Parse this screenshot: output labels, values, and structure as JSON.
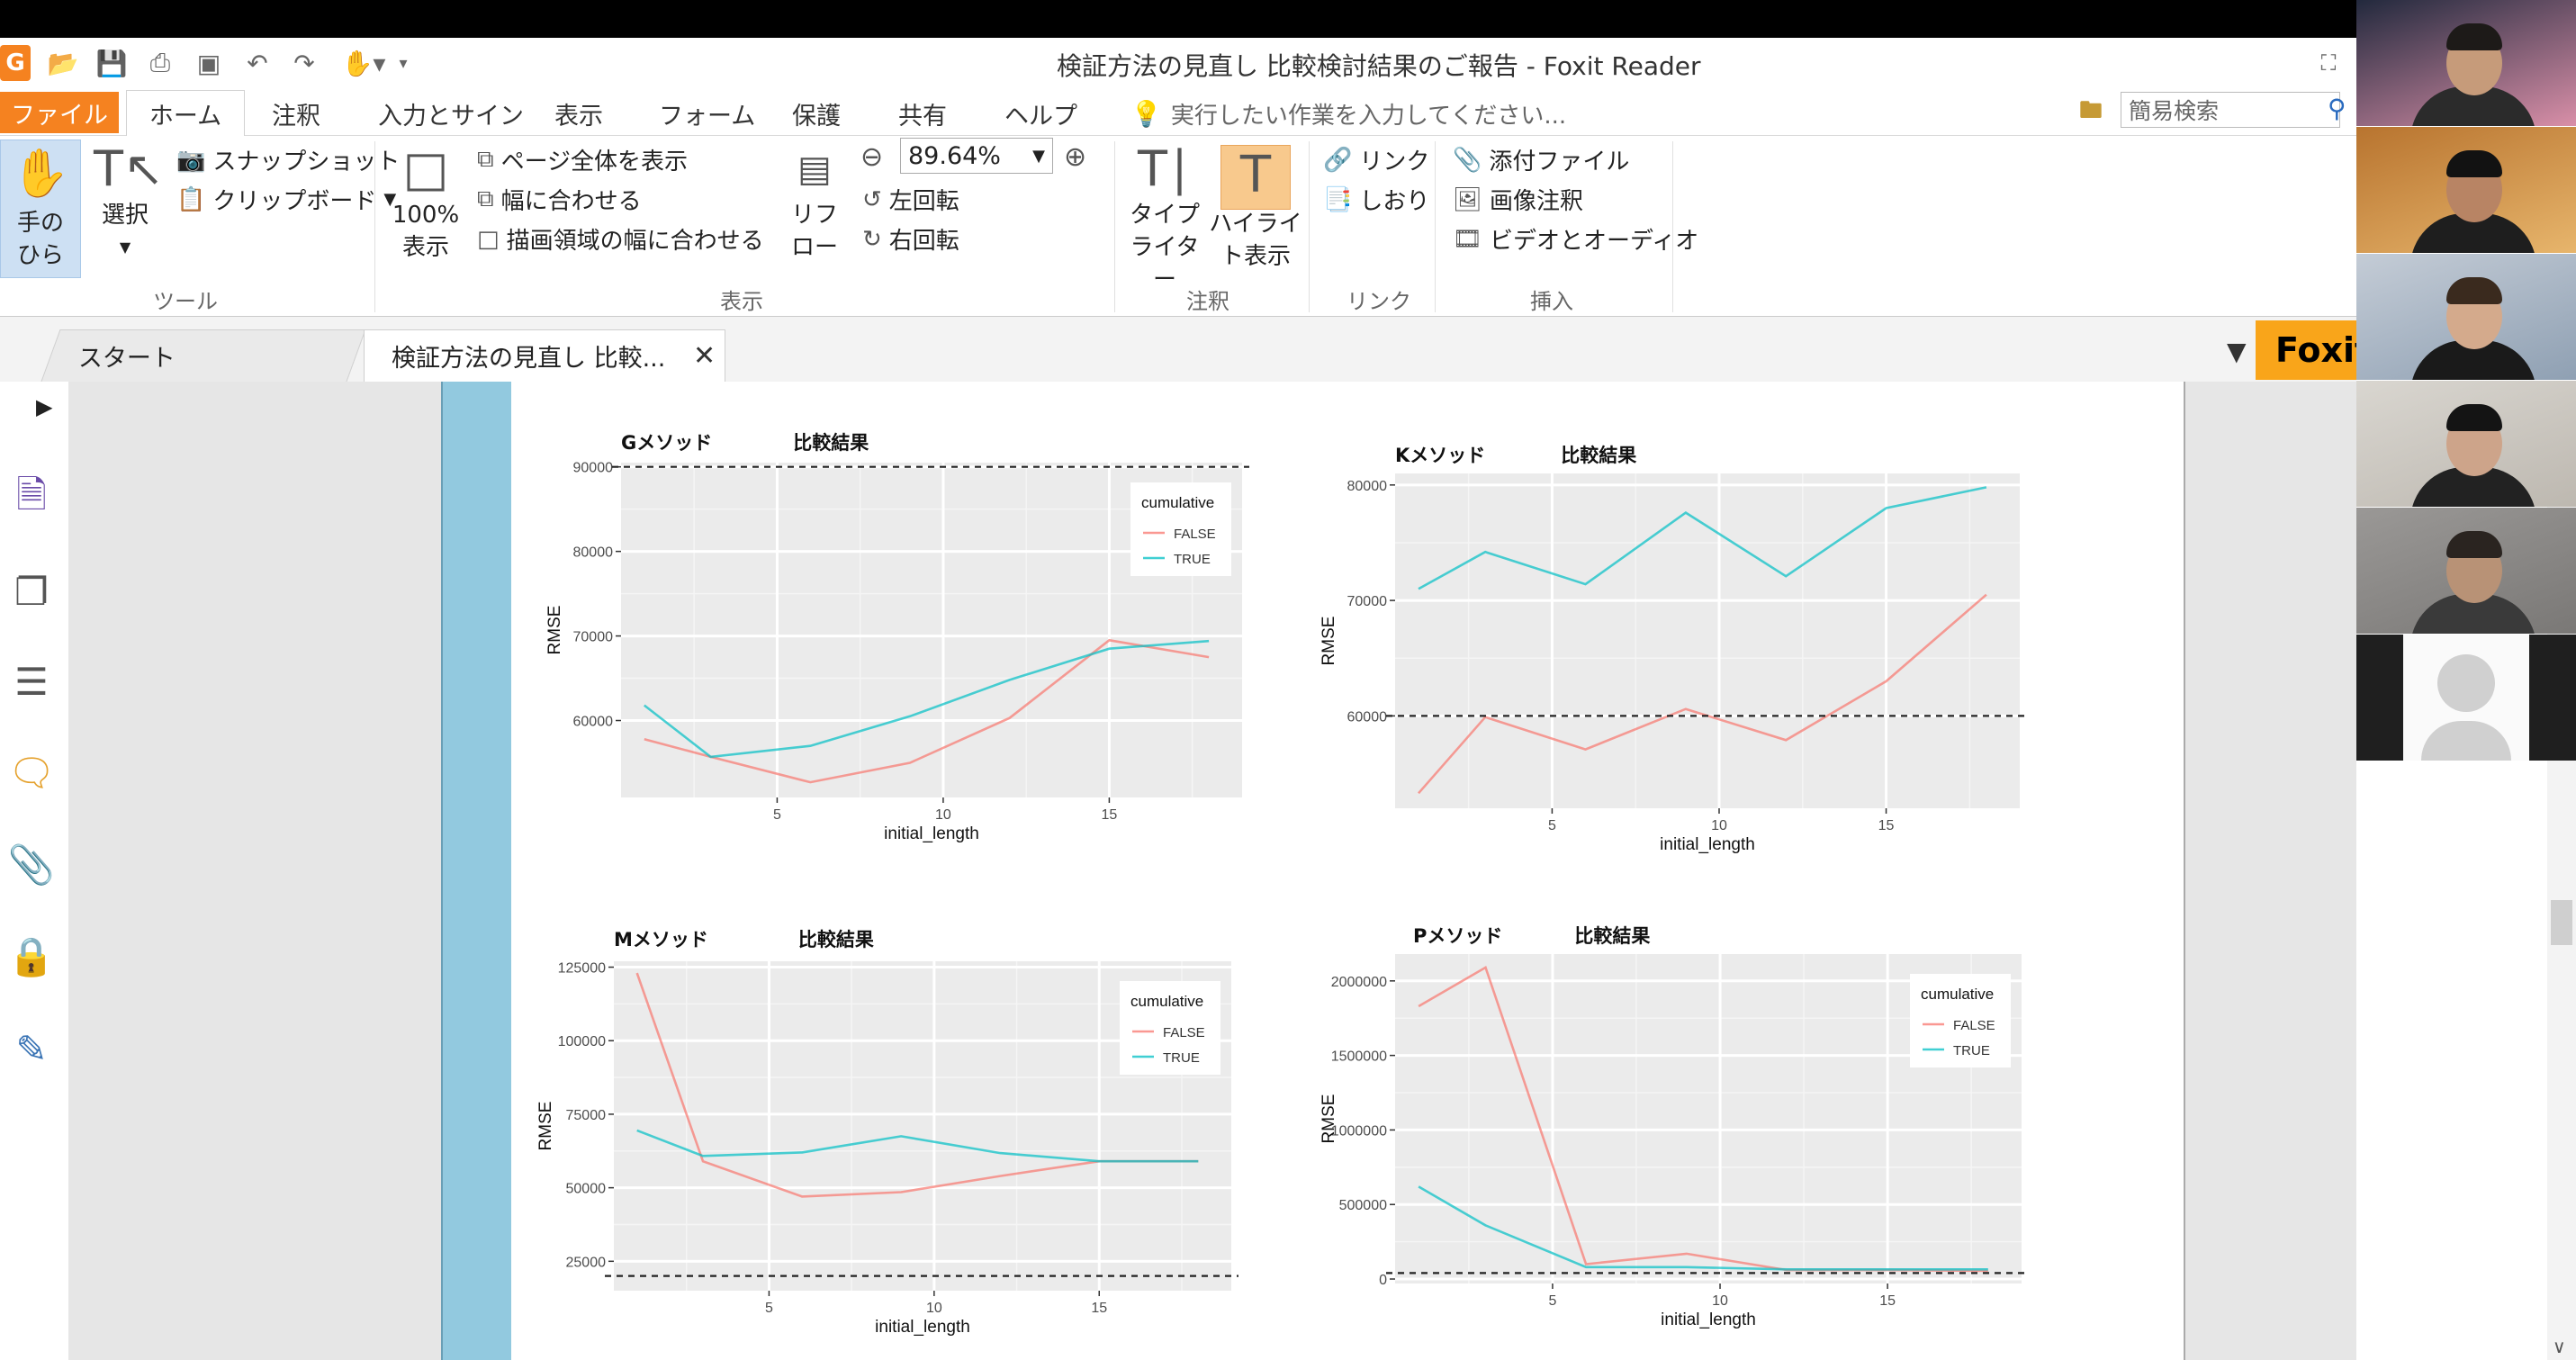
{
  "window": {
    "title": "検証方法の見直し 比較検討結果のご報告 - Foxit Reader",
    "app_logo": "G"
  },
  "quick_access_icons": [
    "open-icon",
    "save-icon",
    "print-icon",
    "scan-icon",
    "undo-icon",
    "redo-icon",
    "hand-dropdown-icon",
    "customize-icon"
  ],
  "menu": {
    "file": "ファイル",
    "tabs": [
      "ホーム",
      "注釈",
      "入力とサイン",
      "表示",
      "フォーム",
      "保護",
      "共有",
      "ヘルプ"
    ],
    "tell_me": "実行したい作業を入力してください...",
    "search_placeholder": "簡易検索"
  },
  "ribbon": {
    "tools": {
      "hand_line1": "手の",
      "hand_line2": "ひら",
      "select": "選択",
      "snapshot": "スナップショット",
      "clipboard": "クリップボード",
      "group": "ツール"
    },
    "view": {
      "actual_size_line1": "100%",
      "actual_size_line2": "表示",
      "fit_page": "ページ全体を表示",
      "fit_width": "幅に合わせる",
      "fit_visible": "描画領域の幅に合わせる",
      "reflow_line1": "リフ",
      "reflow_line2": "ロー",
      "zoom_value": "89.64%",
      "rotate_left": "左回転",
      "rotate_right": "右回転",
      "group": "表示"
    },
    "comment": {
      "typewriter_line1": "タイプ",
      "typewriter_line2": "ライター",
      "highlight_line1": "ハイライ",
      "highlight_line2": "ト表示",
      "group": "注釈"
    },
    "links": {
      "link": "リンク",
      "bookmark": "しおり",
      "group": "リンク"
    },
    "insert": {
      "attachment": "添付ファイル",
      "image_annotation": "画像注釈",
      "video_audio": "ビデオとオーディオ",
      "group": "挿入"
    }
  },
  "doc_tabs": {
    "start": "スタート",
    "current": "検証方法の見直し 比較..."
  },
  "ad_banner": "Foxit",
  "charts": [
    {
      "title": "Gメソッド",
      "title_suffix": "比較結果",
      "xlabel": "initial_length",
      "ylabel": "RMSE",
      "xlim": [
        0.3,
        19.0
      ],
      "ylim": [
        50900,
        90500
      ],
      "yticks": [
        60000,
        70000,
        80000,
        90000
      ],
      "ytick_labels": [
        "60000",
        "70000",
        "80000",
        "90000"
      ],
      "xticks": [
        5,
        10,
        15
      ],
      "hline": 90000,
      "legend": {
        "title": "cumulative",
        "items": [
          "FALSE",
          "TRUE"
        ],
        "position": "top-right"
      },
      "series": [
        {
          "name": "FALSE",
          "color": "#F8766D",
          "x": [
            1,
            3,
            6,
            9,
            12,
            15,
            18
          ],
          "y": [
            57800,
            55700,
            52700,
            55000,
            60300,
            69500,
            67500
          ]
        },
        {
          "name": "TRUE",
          "color": "#00BFC4",
          "x": [
            1,
            3,
            6,
            9,
            12,
            15,
            18
          ],
          "y": [
            61800,
            55700,
            57000,
            60500,
            64800,
            68500,
            69400
          ]
        }
      ]
    },
    {
      "title": "Kメソッド",
      "title_suffix": "比較結果",
      "xlabel": "initial_length",
      "ylabel": "RMSE",
      "xlim": [
        0.3,
        19.0
      ],
      "ylim": [
        52000,
        81000
      ],
      "yticks": [
        60000,
        70000,
        80000
      ],
      "ytick_labels": [
        "60000",
        "70000",
        "80000"
      ],
      "xticks": [
        5,
        10,
        15
      ],
      "hline": 60000,
      "legend": null,
      "series": [
        {
          "name": "FALSE",
          "color": "#F8766D",
          "x": [
            1,
            3,
            6,
            9,
            12,
            15,
            18
          ],
          "y": [
            53300,
            59900,
            57100,
            60600,
            57900,
            63000,
            70500
          ]
        },
        {
          "name": "TRUE",
          "color": "#00BFC4",
          "x": [
            1,
            3,
            6,
            9,
            12,
            15,
            18
          ],
          "y": [
            71000,
            74200,
            71400,
            77600,
            72100,
            78000,
            79800
          ]
        }
      ]
    },
    {
      "title": "Mメソッド",
      "title_suffix": "比較結果",
      "xlabel": "initial_length",
      "ylabel": "RMSE",
      "xlim": [
        0.3,
        19.0
      ],
      "ylim": [
        15000,
        127000
      ],
      "yticks": [
        25000,
        50000,
        75000,
        100000,
        125000
      ],
      "ytick_labels": [
        "25000",
        "50000",
        "75000",
        "100000",
        "125000"
      ],
      "xticks": [
        5,
        10,
        15
      ],
      "hline": 20000,
      "legend": {
        "title": "cumulative",
        "items": [
          "FALSE",
          "TRUE"
        ],
        "position": "top-right"
      },
      "series": [
        {
          "name": "FALSE",
          "color": "#F8766D",
          "x": [
            1,
            3,
            6,
            9,
            12,
            15,
            18
          ],
          "y": [
            123000,
            59000,
            47000,
            48500,
            54000,
            59000,
            59000
          ]
        },
        {
          "name": "TRUE",
          "color": "#00BFC4",
          "x": [
            1,
            3,
            6,
            9,
            12,
            15,
            18
          ],
          "y": [
            69500,
            60800,
            62000,
            67500,
            61800,
            59000,
            59000
          ]
        }
      ]
    },
    {
      "title": "Pメソッド",
      "title_suffix": "比較結果",
      "xlabel": "initial_length",
      "ylabel": "RMSE",
      "xlim": [
        0.3,
        19.0
      ],
      "ylim": [
        -30000,
        2180000
      ],
      "yticks": [
        0,
        500000,
        1000000,
        1500000,
        2000000
      ],
      "ytick_labels": [
        "0",
        "500000",
        "1000000",
        "1500000",
        "2000000"
      ],
      "xticks": [
        5,
        10,
        15
      ],
      "hline": 40000,
      "legend": {
        "title": "cumulative",
        "items": [
          "FALSE",
          "TRUE"
        ],
        "position": "top-right"
      },
      "series": [
        {
          "name": "FALSE",
          "color": "#F8766D",
          "x": [
            1,
            3,
            6,
            9,
            12,
            15,
            18
          ],
          "y": [
            1830000,
            2090000,
            100000,
            170000,
            60000,
            60000,
            55000
          ]
        },
        {
          "name": "TRUE",
          "color": "#00BFC4",
          "x": [
            1,
            3,
            6,
            9,
            12,
            15,
            18
          ],
          "y": [
            620000,
            360000,
            80000,
            80000,
            65000,
            65000,
            65000
          ]
        }
      ]
    }
  ],
  "participants": [
    {
      "bg": "#22293d",
      "accent": "#d98fa8",
      "skin": "#c69b7a",
      "hair": "#1d1a18",
      "shirt": "#2b2b2b"
    },
    {
      "bg": "#b8742f",
      "accent": "#e7b56c",
      "skin": "#b88464",
      "hair": "#121212",
      "shirt": "#1e1e1e"
    },
    {
      "bg": "#c4ccd6",
      "accent": "#8fa0b3",
      "skin": "#d4aa8c",
      "hair": "#3a2a1e",
      "shirt": "#1a1a1a"
    },
    {
      "bg": "#d9d6d0",
      "accent": "#bdb8b0",
      "skin": "#cda48a",
      "hair": "#141414",
      "shirt": "#222222"
    },
    {
      "bg": "#9a9896",
      "accent": "#7a7876",
      "skin": "#b89276",
      "hair": "#2a2420",
      "shirt": "#3a3a3a"
    },
    {
      "bg": "#1f1f1f",
      "accent": "#e4e4e4",
      "skin": "#d0d0d0",
      "hair": "#d0d0d0",
      "shirt": "#d0d0d0"
    }
  ]
}
